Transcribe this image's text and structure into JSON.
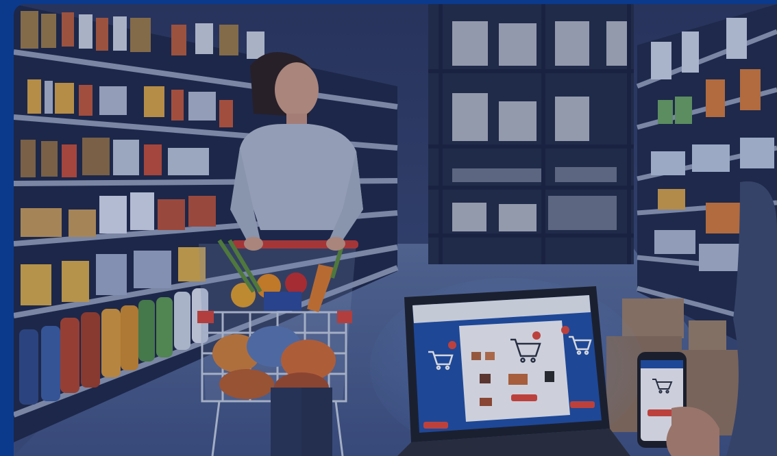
{
  "scene": {
    "colors": {
      "frame": "#0b3a8c",
      "ambient": "#3b4a78",
      "floor": "#4d6290",
      "laptop_screen": "#1f4fa6",
      "accent_red": "#e0473a"
    },
    "icons": [
      "shopping-cart-icon",
      "shopping-cart-icon",
      "shopping-cart-icon",
      "shopping-cart-icon"
    ]
  }
}
